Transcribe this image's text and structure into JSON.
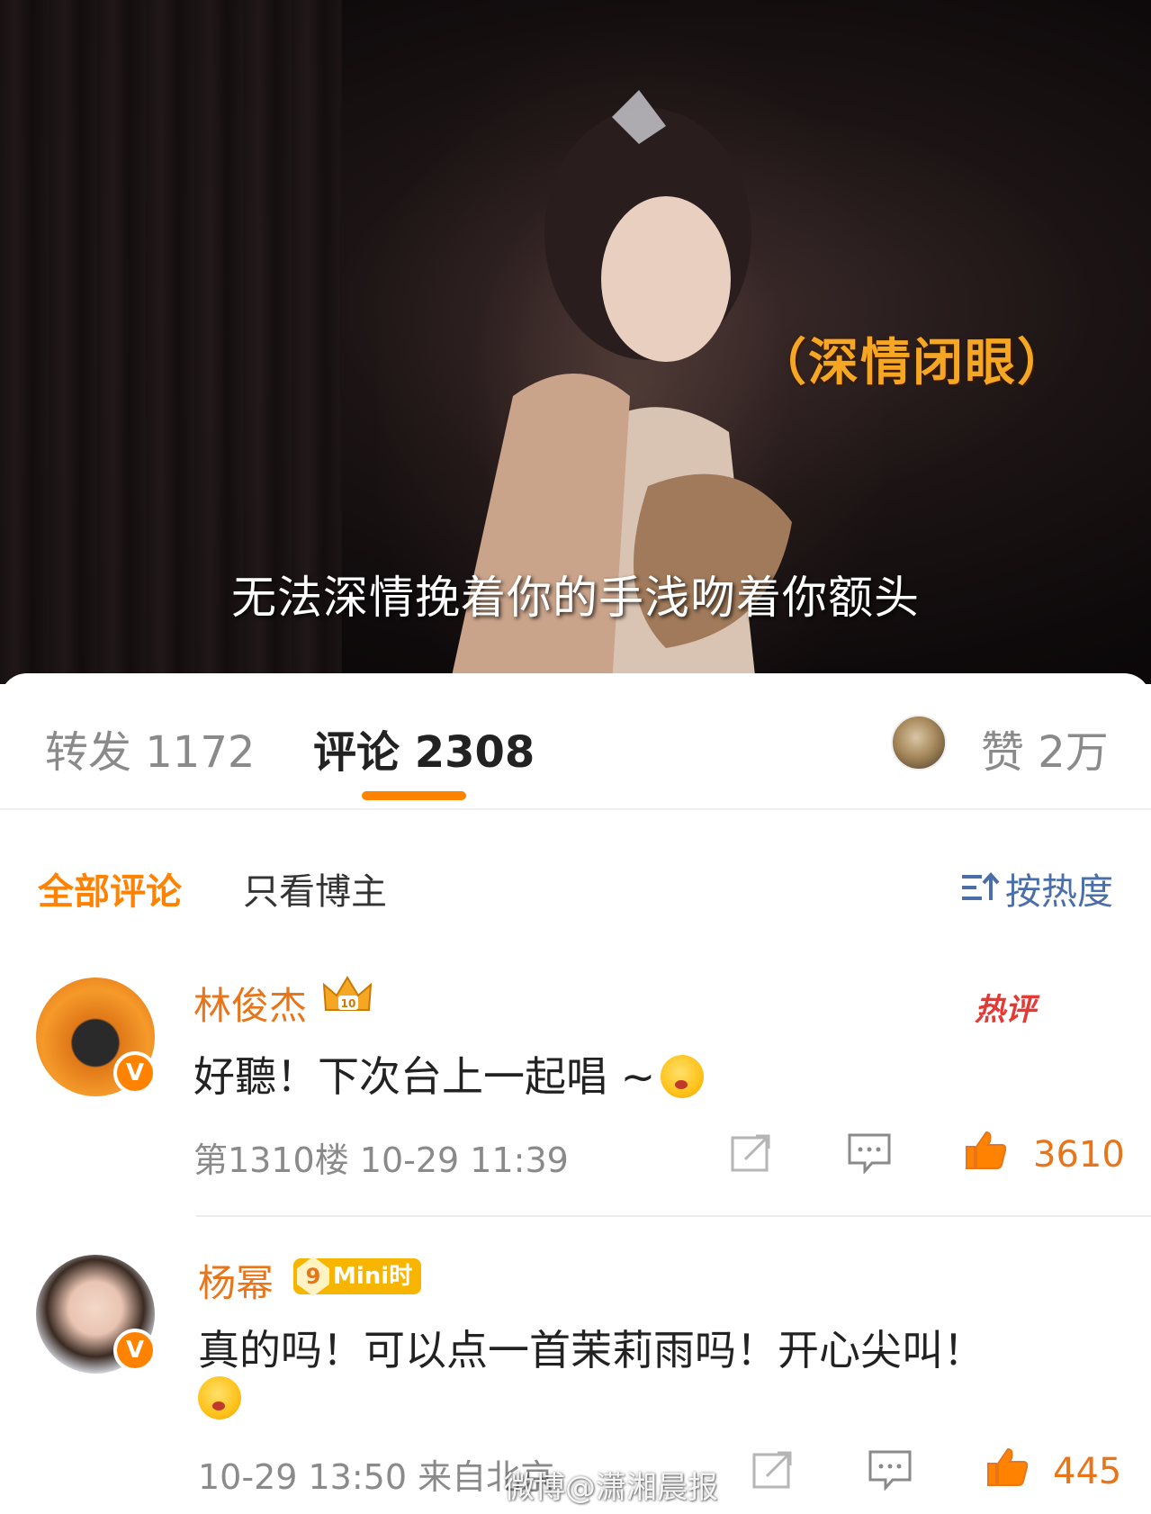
{
  "video": {
    "caption_tag": "（深情闭眼）",
    "subtitle": "无法深情挽着你的手浅吻着你额头"
  },
  "tabs": {
    "repost": "转发 1172",
    "comment": "评论 2308",
    "like": "赞 2万"
  },
  "filters": {
    "all": "全部评论",
    "blogger_only": "只看博主",
    "sort": "按热度",
    "sort_icon": "sort-icon"
  },
  "comments": [
    {
      "name": "林俊杰",
      "badge": "crown-badge",
      "hot_tag": "热评",
      "text": "好聽！下次台上一起唱 ~",
      "emoji": "blushing-face",
      "meta": "第1310楼 10-29 11:39",
      "likes": "3610"
    },
    {
      "name": "杨幂",
      "badge_text": "Mini时",
      "badge_level": "9",
      "text_line1": "真的吗！可以点一首茉莉雨吗！开心尖叫！",
      "emoji": "laughing-face",
      "meta": "10-29 13:50 来自北京",
      "likes": "445"
    }
  ],
  "watermark": "微博@潇湘晨报",
  "colors": {
    "accent": "#ff8200",
    "name": "#e8751a",
    "sort": "#4a6ea9",
    "hot": "#e53935"
  }
}
